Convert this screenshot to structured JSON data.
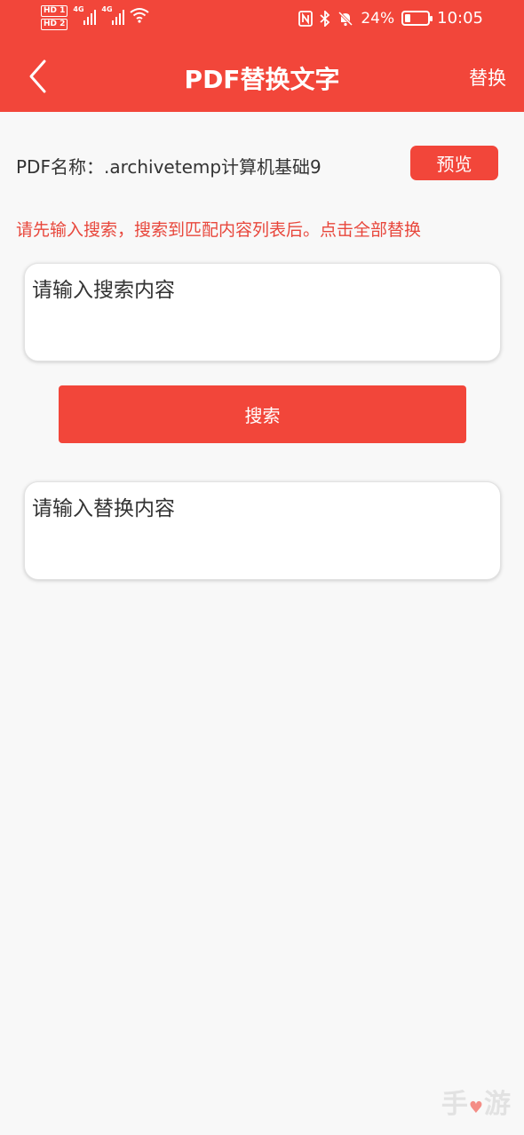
{
  "status_bar": {
    "hd1": "HD 1",
    "hd2": "HD 2",
    "net1": "4G",
    "net2": "4G",
    "battery_percent": "24%",
    "battery_level": 0.24,
    "time": "10:05",
    "icons": [
      "nfc-icon",
      "bluetooth-icon",
      "mute-bell-icon",
      "wifi-icon",
      "battery-icon"
    ]
  },
  "header": {
    "title": "PDF替换文字",
    "action_label": "替换",
    "back_icon": "chevron-left-icon"
  },
  "pdf_info": {
    "label": "PDF名称：",
    "name": ".archivetemp计算机基础9",
    "preview_label": "预览"
  },
  "hint_text": "请先输入搜索，搜索到匹配内容列表后。点击全部替换",
  "search": {
    "placeholder": "请输入搜索内容",
    "button_label": "搜索"
  },
  "replace": {
    "placeholder": "请输入替换内容"
  },
  "colors": {
    "accent": "#f2463a",
    "hint": "#e8473c",
    "background": "#f8f8f8"
  }
}
